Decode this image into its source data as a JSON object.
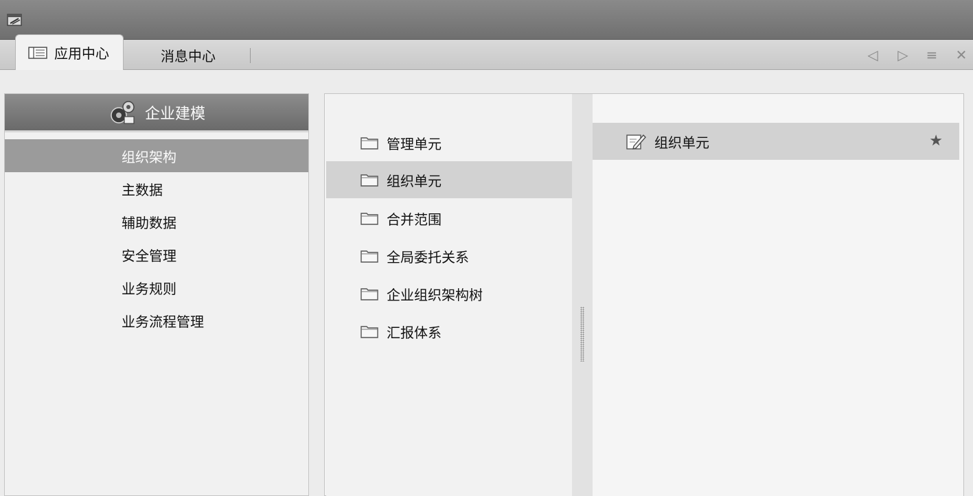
{
  "tabs": [
    {
      "label": "应用中心",
      "active": true
    },
    {
      "label": "消息中心",
      "active": false
    }
  ],
  "tab_controls": {
    "prev": "◁",
    "next": "▷",
    "menu": "≡",
    "close": "✕"
  },
  "left_panel": {
    "header": "企业建模",
    "items": [
      {
        "label": "组织架构",
        "selected": true
      },
      {
        "label": "主数据"
      },
      {
        "label": "辅助数据"
      },
      {
        "label": "安全管理"
      },
      {
        "label": "业务规则"
      },
      {
        "label": "业务流程管理"
      }
    ]
  },
  "folders": [
    {
      "label": "管理单元"
    },
    {
      "label": "组织单元",
      "selected": true
    },
    {
      "label": "合并范围"
    },
    {
      "label": "全局委托关系"
    },
    {
      "label": "企业组织架构树"
    },
    {
      "label": "汇报体系"
    }
  ],
  "content": {
    "item_label": "组织单元",
    "star": "★"
  }
}
